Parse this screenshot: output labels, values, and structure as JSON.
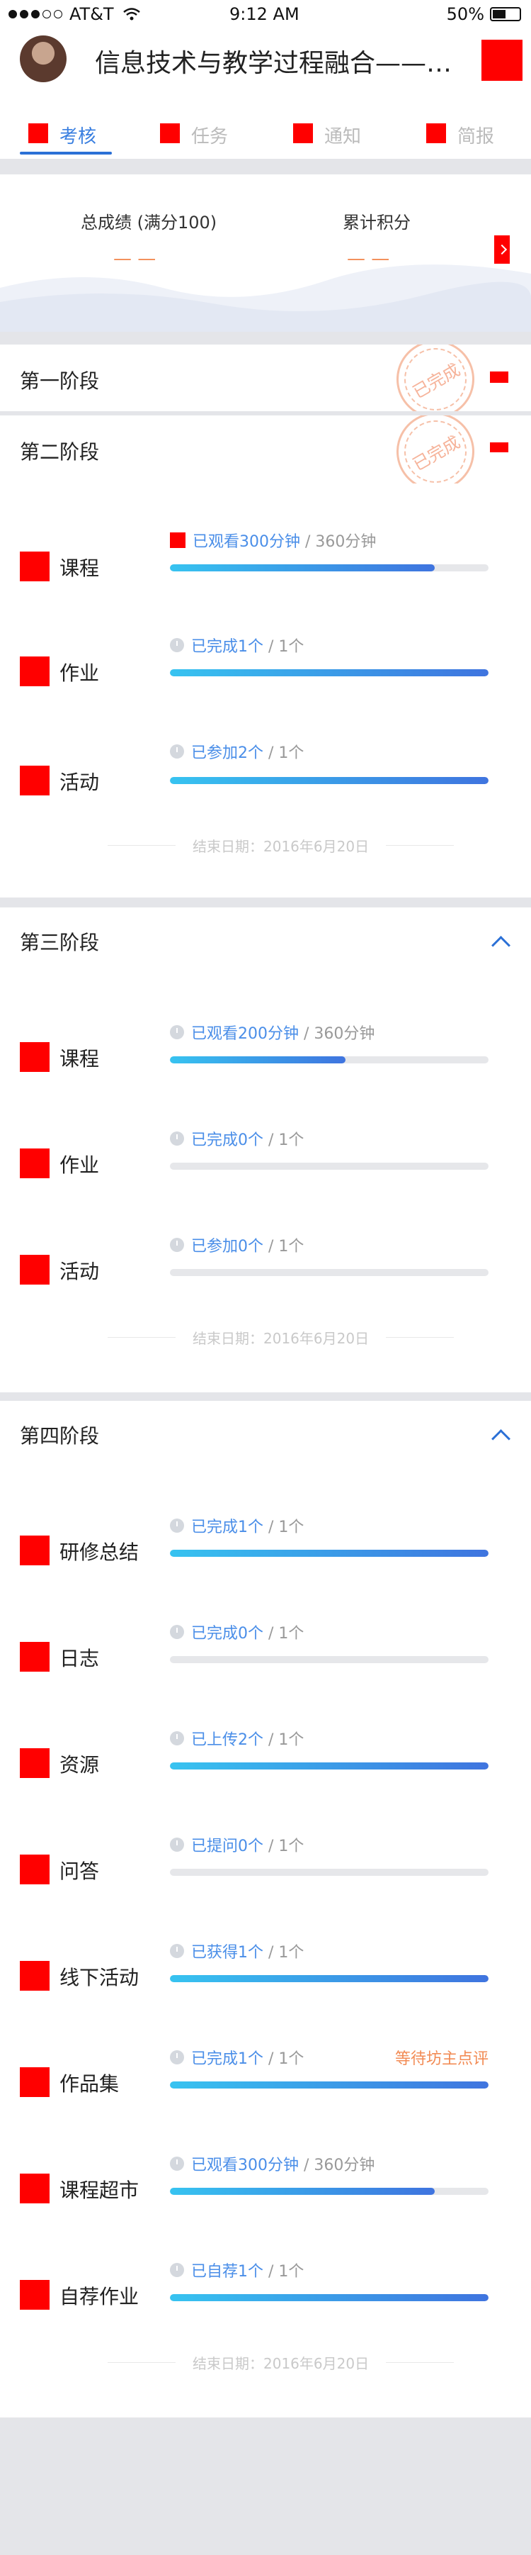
{
  "status_bar": {
    "carrier": "AT&T",
    "time": "9:12 AM",
    "battery": "50%"
  },
  "header": {
    "title": "信息技术与教学过程融合——教学设计"
  },
  "tabs": [
    {
      "label": "考核",
      "active": true
    },
    {
      "label": "任务",
      "active": false
    },
    {
      "label": "通知",
      "active": false
    },
    {
      "label": "简报",
      "active": false
    }
  ],
  "summary": {
    "total_label": "总成绩 (满分100)",
    "total_value": "— —",
    "points_label": "累计积分",
    "points_value": "— —"
  },
  "stages": [
    {
      "title": "第一阶段",
      "stamp": "已完成",
      "icon": "mail-icon"
    },
    {
      "title": "第二阶段",
      "stamp": "已完成",
      "icon": "mail-icon",
      "rows": [
        {
          "label": "课程",
          "meta": "已观看300分钟",
          "limit": " / 360分钟",
          "progress": 0.83
        },
        {
          "label": "作业",
          "meta": "已完成1个",
          "limit": " / 1个",
          "progress": 1.0
        },
        {
          "label": "活动",
          "meta": "已参加2个",
          "limit": " / 1个",
          "progress": 1.0
        }
      ],
      "end_date": "结束日期：2016年6月20日"
    },
    {
      "title": "第三阶段",
      "icon": "chevron-up-icon",
      "rows": [
        {
          "label": "课程",
          "meta": "已观看200分钟",
          "limit": " / 360分钟",
          "progress": 0.55
        },
        {
          "label": "作业",
          "meta": "已完成0个",
          "limit": " / 1个",
          "progress": 0.0
        },
        {
          "label": "活动",
          "meta": "已参加0个",
          "limit": " / 1个",
          "progress": 0.0
        }
      ],
      "end_date": "结束日期：2016年6月20日"
    },
    {
      "title": "第四阶段",
      "icon": "chevron-up-icon",
      "rows": [
        {
          "label": "研修总结",
          "meta": "已完成1个",
          "limit": " / 1个",
          "progress": 1.0
        },
        {
          "label": "日志",
          "meta": "已完成0个",
          "limit": " / 1个",
          "progress": 0.0
        },
        {
          "label": "资源",
          "meta": "已上传2个",
          "limit": " / 1个",
          "progress": 1.0
        },
        {
          "label": "问答",
          "meta": "已提问0个",
          "limit": " / 1个",
          "progress": 0.0
        },
        {
          "label": "线下活动",
          "meta": "已获得1个",
          "limit": " / 1个",
          "progress": 1.0
        },
        {
          "label": "作品集",
          "meta": "已完成1个",
          "limit": " / 1个",
          "progress": 1.0,
          "status": "等待坊主点评"
        },
        {
          "label": "课程超市",
          "meta": "已观看300分钟",
          "limit": " / 360分钟",
          "progress": 0.83
        },
        {
          "label": "自荐作业",
          "meta": "已自荐1个",
          "limit": " / 1个",
          "progress": 1.0
        }
      ],
      "end_date": "结束日期：2016年6月20日"
    }
  ],
  "colors": {
    "accent": "#2b70d6",
    "progress_start": "#37c3f0",
    "progress_end": "#3f74df",
    "pending": "#f28b54",
    "placeholder_icon": "#ff0000"
  }
}
